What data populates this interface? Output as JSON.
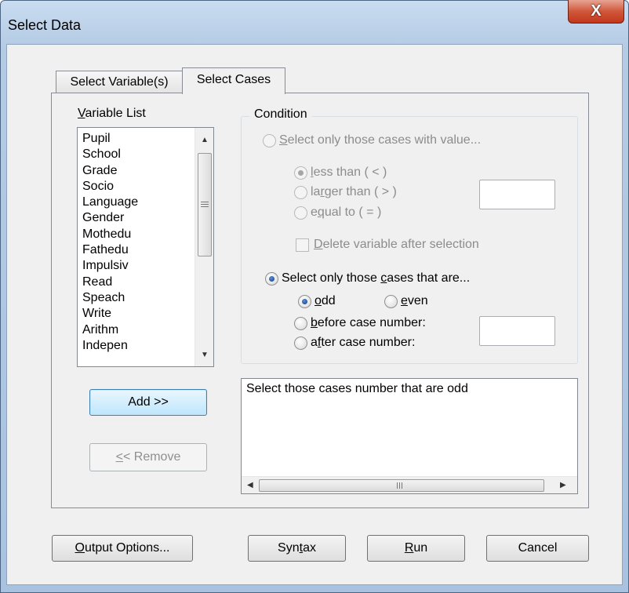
{
  "window": {
    "title": "Select Data",
    "close_glyph": "X"
  },
  "tabs": [
    {
      "label": "Select Variable(s)",
      "active": false
    },
    {
      "label": "Select Cases",
      "active": true
    }
  ],
  "variable_list": {
    "label_prefix": "",
    "label_underlined": "V",
    "label_rest": "ariable List",
    "items": [
      "Pupil",
      "School",
      "Grade",
      "Socio",
      "Language",
      "Gender",
      "Mothedu",
      "Fathedu",
      "Impulsiv",
      "Read",
      "Speach",
      "Write",
      "Arithm",
      "Indepen"
    ]
  },
  "buttons": {
    "add": "Add >>",
    "remove_underlined": "<",
    "remove_rest": "< Remove"
  },
  "condition": {
    "label": "Condition",
    "by_value": {
      "u": "S",
      "rest": "elect only those cases with value...",
      "checked": false,
      "enabled": false
    },
    "less_than": {
      "u": "l",
      "rest": "ess than ( < )",
      "checked": true,
      "enabled": false
    },
    "larger_than": {
      "pre": "la",
      "u": "r",
      "rest": "ger than ( > )",
      "checked": false,
      "enabled": false
    },
    "equal_to": {
      "pre": "e",
      "u": "q",
      "rest": "ual to ( = )",
      "checked": false,
      "enabled": false
    },
    "delete_var": {
      "u": "D",
      "rest": "elete variable after selection",
      "checked": false,
      "enabled": false
    },
    "value_input": "",
    "by_case": {
      "pre": "Select only those ",
      "u": "c",
      "rest": "ases that are...",
      "checked": true
    },
    "odd": {
      "u": "o",
      "rest": "dd",
      "checked": true
    },
    "even": {
      "u": "e",
      "rest": "ven",
      "checked": false
    },
    "before": {
      "u": "b",
      "rest": "efore case number:",
      "checked": false
    },
    "after": {
      "pre": "a",
      "u": "f",
      "rest": "ter case number:",
      "checked": false
    },
    "case_number_input": ""
  },
  "description": "Select those cases number that are odd",
  "footer": {
    "output_options": {
      "u": "O",
      "rest": "utput Options..."
    },
    "syntax": {
      "pre": "Syn",
      "u": "t",
      "rest": "ax"
    },
    "run": {
      "u": "R",
      "rest": "un"
    },
    "cancel": "Cancel"
  }
}
